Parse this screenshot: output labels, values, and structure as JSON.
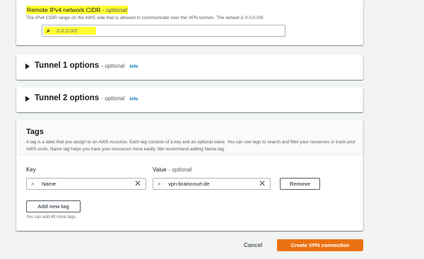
{
  "cidr": {
    "label": "Remote IPv4 network CIDR",
    "optional": "- optional",
    "description": "The IPv4 CIDR range on the AWS side that is allowed to communicate over the VPN tunnels. The default is 0.0.0.0/0.",
    "placeholder": "0.0.0.0/0"
  },
  "tunnel1": {
    "title": "Tunnel 1 options",
    "optional": "- optional",
    "info": "Info"
  },
  "tunnel2": {
    "title": "Tunnel 2 options",
    "optional": "- optional",
    "info": "Info"
  },
  "tags": {
    "title": "Tags",
    "description": "A tag is a label that you assign to an AWS resource. Each tag consists of a key and an optional value. You can use tags to search and filter your resources or track your AWS costs. Name tag helps you track your resources more easily. We recommend adding Name tag.",
    "key_label": "Key",
    "value_label": "Value",
    "value_optional": "- optional",
    "key_value": "Name",
    "value_value": "vpn-braincourt.de",
    "remove_label": "Remove",
    "add_label": "Add new tag",
    "hint": "You can add 49 more tags."
  },
  "footer": {
    "cancel": "Cancel",
    "create": "Create VPN connection"
  },
  "colors": {
    "highlight": "#ffff33",
    "primary": "#ec7211",
    "link": "#0073bb"
  },
  "icons": {
    "search": "search-icon",
    "clear": "close-icon",
    "caret": "caret-right-icon"
  }
}
